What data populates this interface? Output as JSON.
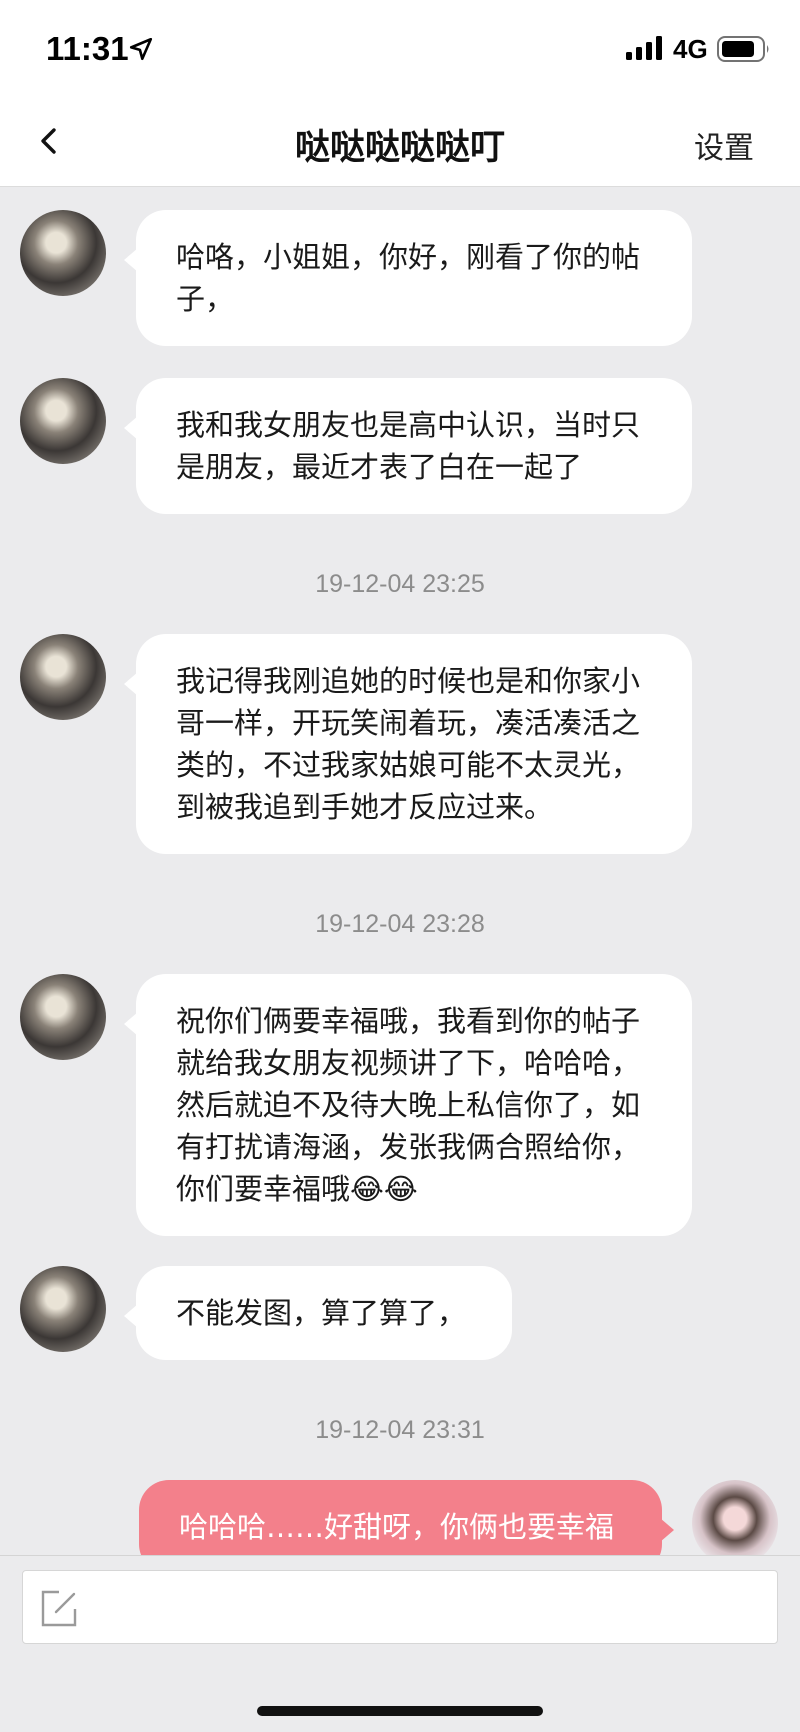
{
  "status_bar": {
    "time": "11:31",
    "network": "4G"
  },
  "header": {
    "title": "哒哒哒哒哒叮",
    "settings_label": "设置"
  },
  "messages": [
    {
      "text": "哈咯，小姐姐，你好，刚看了你的帖子，",
      "sender": "other"
    },
    {
      "text": "我和我女朋友也是高中认识，当时只是朋友，最近才表了白在一起了",
      "sender": "other"
    },
    {
      "text": "我记得我刚追她的时候也是和你家小哥一样，开玩笑闹着玩，凑活凑活之类的，不过我家姑娘可能不太灵光，到被我追到手她才反应过来。",
      "sender": "other"
    },
    {
      "text": "祝你们俩要幸福哦，我看到你的帖子就给我女朋友视频讲了下，哈哈哈，然后就迫不及待大晚上私信你了，如有打扰请海涵，发张我俩合照给你，你们要幸福哦😂😂",
      "sender": "other"
    },
    {
      "text": "不能发图，算了算了，",
      "sender": "other"
    },
    {
      "text": "哈哈哈……好甜呀，你俩也要幸福",
      "sender": "me"
    }
  ],
  "timestamps": [
    "19-12-04 23:25",
    "19-12-04 23:28",
    "19-12-04 23:31"
  ],
  "colors": {
    "my_bubble": "#f3808b",
    "other_bubble": "#ffffff",
    "background": "#ebebed"
  },
  "icons": {
    "back": "chevron-left-icon",
    "compose": "compose-icon",
    "location": "location-arrow-icon",
    "signal": "signal-icon",
    "battery": "battery-icon"
  }
}
